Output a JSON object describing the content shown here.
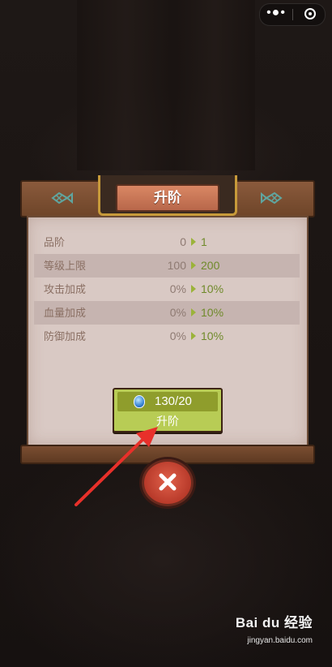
{
  "panel": {
    "title": "升阶",
    "stats": [
      {
        "label": "品阶",
        "current": "0",
        "next": "1"
      },
      {
        "label": "等级上限",
        "current": "100",
        "next": "200"
      },
      {
        "label": "攻击加成",
        "current": "0%",
        "next": "10%"
      },
      {
        "label": "血量加成",
        "current": "0%",
        "next": "10%"
      },
      {
        "label": "防御加成",
        "current": "0%",
        "next": "10%"
      }
    ],
    "upgrade_button": {
      "cost": "130/20",
      "label": "升阶",
      "icon": "blue-gem-icon"
    }
  },
  "close_button": {
    "icon": "close-x-icon"
  },
  "mini_program_capsule": {
    "more": "•●•",
    "close_icon": "target-circle-icon"
  },
  "watermark": {
    "logo": "Bai du 经验",
    "url": "jingyan.baidu.com"
  },
  "colors": {
    "accent_green": "#b8cc55",
    "next_value_green": "#6f8a2a",
    "close_red": "#c9452f",
    "title_plate": "#c9775a",
    "annotation_arrow": "#e8302a"
  }
}
